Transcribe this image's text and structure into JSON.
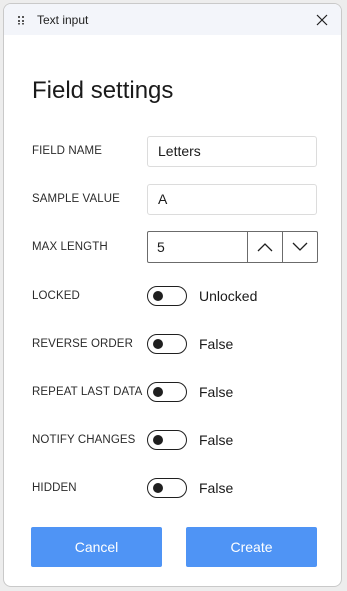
{
  "window": {
    "title": "Text input",
    "title_icon": "grid-dots-icon",
    "close_icon": "close-icon"
  },
  "form": {
    "heading": "Field settings",
    "field_name": {
      "label": "FIELD NAME",
      "value": "Letters"
    },
    "sample_value": {
      "label": "SAMPLE VALUE",
      "value": "A"
    },
    "max_length": {
      "label": "MAX LENGTH",
      "value": "5",
      "up_icon": "chevron-up-icon",
      "down_icon": "chevron-down-icon"
    },
    "locked": {
      "label": "LOCKED",
      "state": "Unlocked",
      "on": false
    },
    "reverse_order": {
      "label": "REVERSE ORDER",
      "state": "False",
      "on": false
    },
    "repeat_last_data": {
      "label": "REPEAT LAST DATA",
      "state": "False",
      "on": false
    },
    "notify_changes": {
      "label": "NOTIFY CHANGES",
      "state": "False",
      "on": false
    },
    "hidden": {
      "label": "HIDDEN",
      "state": "False",
      "on": false
    }
  },
  "actions": {
    "cancel_label": "Cancel",
    "create_label": "Create"
  },
  "colors": {
    "accent": "#4f94f5",
    "titlebar": "#f3f5fa"
  }
}
